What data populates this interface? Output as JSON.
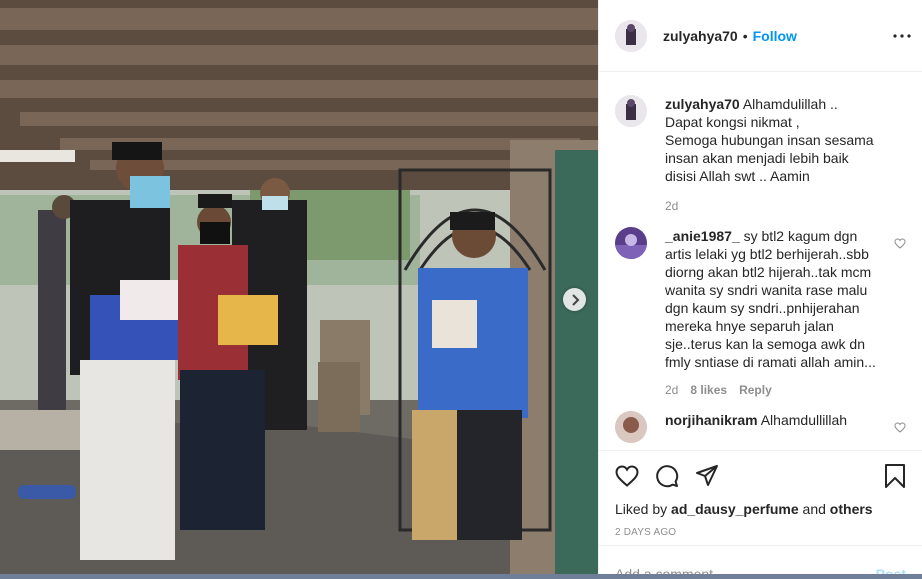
{
  "post": {
    "username": "zulyahya70",
    "follow_label": "Follow",
    "separator": "•"
  },
  "caption": {
    "username": "zulyahya70",
    "text": "Alhamdulillah .. Dapat kongsi nikmat ,\nSemoga hubungan insan sesama insan akan menjadi lebih baik disisi Allah swt .. Aamin",
    "time": "2d"
  },
  "comments": [
    {
      "username": "_anie1987_",
      "text": "sy btl2 kagum dgn artis lelaki yg btl2 berhijerah..sbb diorng akan btl2 hijerah..tak mcm wanita sy sndri wanita rase malu dgn kaum sy sndri..pnhijerahan mereka hnye separuh jalan sje..terus kan la semoga awk dn fmly sntiase di ramati allah amin...",
      "time": "2d",
      "likes": "8 likes",
      "reply": "Reply"
    },
    {
      "username": "norjihanikram",
      "text": "Alhamdullillah",
      "time": "",
      "likes": "",
      "reply": ""
    }
  ],
  "engagement": {
    "liked_prefix": "Liked by",
    "liked_user": "ad_dausy_perfume",
    "liked_and": "and",
    "liked_others": "others",
    "date": "2 DAYS AGO"
  },
  "add_comment": {
    "placeholder": "Add a comment...",
    "post_label": "Post"
  },
  "icons": {
    "more": "more-horizontal-icon",
    "next": "chevron-right-icon",
    "like": "heart-icon",
    "comment": "comment-bubble-icon",
    "share": "paper-plane-icon",
    "save": "bookmark-icon"
  },
  "colors": {
    "follow": "#0095f6",
    "post_disabled": "#b2dffc",
    "muted": "#8e8e8e",
    "text": "#262626"
  }
}
